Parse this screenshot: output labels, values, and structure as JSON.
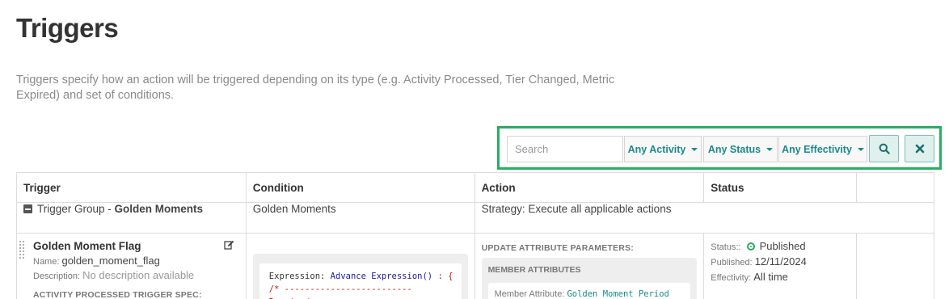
{
  "page": {
    "title": "Triggers",
    "description": "Triggers specify how an action will be triggered depending on its type (e.g. Activity Processed, Tier Changed, Metric Expired) and set of conditions."
  },
  "filters": {
    "search_placeholder": "Search",
    "activity_label": "Any Activity",
    "status_label": "Any Status",
    "effectivity_label": "Any Effectivity",
    "highlight_color": "#27ae60",
    "accent_color": "#1a8a8a"
  },
  "table": {
    "headers": [
      "Trigger",
      "Condition",
      "Action",
      "Status",
      ""
    ],
    "group": {
      "prefix": "Trigger Group - ",
      "name": "Golden Moments",
      "condition": "Golden Moments",
      "action": "Strategy: Execute all applicable actions"
    },
    "trigger": {
      "title": "Golden Moment Flag",
      "name_label": "Name:",
      "name_value": "golden_moment_flag",
      "description_label": "Description:",
      "description_value": "No description available",
      "spec_label": "ACTIVITY PROCESSED TRIGGER SPEC:",
      "condition": {
        "expression_label": "Expression:",
        "expression_fn": "Advance Expression()",
        "expression_suffix": ": {",
        "comment_line": "/* ------------------------- Required"
      },
      "action": {
        "section_label": "UPDATE ATTRIBUTE PARAMETERS:",
        "attributes_title": "MEMBER ATTRIBUTES",
        "attribute_label": "Member Attribute:",
        "attribute_value": "Golden Moment Period"
      },
      "status": {
        "status_label": "Status::",
        "status_value": "Published",
        "published_label": "Published:",
        "published_value": "12/11/2024",
        "effectivity_label": "Effectivity:",
        "effectivity_value": "All time"
      }
    }
  }
}
